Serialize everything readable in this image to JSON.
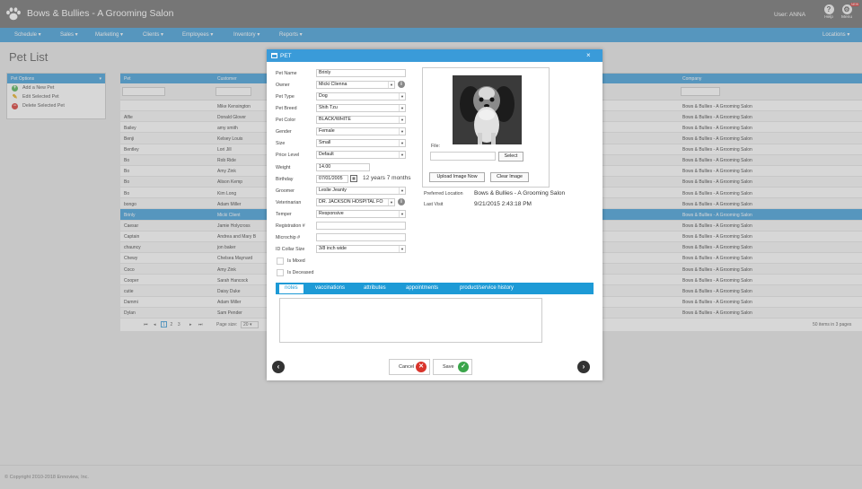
{
  "app": {
    "title": "Bows & Bullies - A Grooming Salon",
    "user_label": "User: ANNA",
    "help_label": "Help",
    "menu_label": "Menu",
    "menu_badge": "NEW",
    "accent_color": "#3a9bd9"
  },
  "nav": {
    "items": [
      "Schedule ▾",
      "Sales ▾",
      "Marketing ▾",
      "Clients ▾",
      "Employees ▾",
      "Inventory ▾",
      "Reports ▾"
    ],
    "locations": "Locations ▾"
  },
  "page": {
    "title": "Pet List"
  },
  "pet_options": {
    "title": "Pet Options",
    "items": [
      {
        "label": "Add a New Pet",
        "icon": "plus-icon"
      },
      {
        "label": "Edit Selected Pet",
        "icon": "pencil-icon"
      },
      {
        "label": "Delete Selected Pet",
        "icon": "minus-icon"
      }
    ]
  },
  "grid": {
    "columns": {
      "pet": "Pet",
      "customer": "Customer",
      "company": "Company"
    },
    "rows": [
      {
        "pet": "",
        "customer": "Mike Kensington",
        "company": "Bows & Bullies - A Grooming Salon"
      },
      {
        "pet": "Alfie",
        "customer": "Donald Glover",
        "company": "Bows & Bullies - A Grooming Salon"
      },
      {
        "pet": "Bailey",
        "customer": "amy smith",
        "company": "Bows & Bullies - A Grooming Salon"
      },
      {
        "pet": "Benji",
        "customer": "Kelsey Louis",
        "company": "Bows & Bullies - A Grooming Salon"
      },
      {
        "pet": "Bentley",
        "customer": "Lori Jill",
        "company": "Bows & Bullies - A Grooming Salon"
      },
      {
        "pet": "Bo",
        "customer": "Rob Ride",
        "company": "Bows & Bullies - A Grooming Salon"
      },
      {
        "pet": "Bo",
        "customer": "Amy Zink",
        "company": "Bows & Bullies - A Grooming Salon"
      },
      {
        "pet": "Bo",
        "customer": "Alison Kemp",
        "company": "Bows & Bullies - A Grooming Salon"
      },
      {
        "pet": "Bo",
        "customer": "Kim Long",
        "company": "Bows & Bullies - A Grooming Salon"
      },
      {
        "pet": "bongo",
        "customer": "Adam Miller",
        "company": "Bows & Bullies - A Grooming Salon"
      },
      {
        "pet": "Brinly",
        "customer": "Micki Client",
        "company": "Bows & Bullies - A Grooming Salon"
      },
      {
        "pet": "Caesar",
        "customer": "Jamie Holycross",
        "company": "Bows & Bullies - A Grooming Salon"
      },
      {
        "pet": "Captain",
        "customer": "Andrea and Mary B",
        "company": "Bows & Bullies - A Grooming Salon"
      },
      {
        "pet": "chauncy",
        "customer": "jon baker",
        "company": "Bows & Bullies - A Grooming Salon"
      },
      {
        "pet": "Chewy",
        "customer": "Chelsea Maynard",
        "company": "Bows & Bullies - A Grooming Salon"
      },
      {
        "pet": "Coco",
        "customer": "Amy Zink",
        "company": "Bows & Bullies - A Grooming Salon"
      },
      {
        "pet": "Cooper",
        "customer": "Sarah Hancock",
        "company": "Bows & Bullies - A Grooming Salon"
      },
      {
        "pet": "cutie",
        "customer": "Daisy Duke",
        "company": "Bows & Bullies - A Grooming Salon"
      },
      {
        "pet": "Dammi",
        "customer": "Adam Miller",
        "company": "Bows & Bullies - A Grooming Salon"
      },
      {
        "pet": "Dylan",
        "customer": "Sam Pender",
        "company": "Bows & Bullies - A Grooming Salon"
      }
    ],
    "selected_index": 10,
    "pager": {
      "pages": [
        "1",
        "2",
        "3"
      ],
      "current": "1",
      "first": "⏮",
      "prev": "◂",
      "next": "▸",
      "last": "⏭",
      "page_size_label": "Page size:",
      "page_size": "20",
      "summary": "50 items in 3 pages"
    }
  },
  "modal": {
    "title": "PET",
    "close": "×",
    "fields": {
      "pet_name": {
        "label": "Pet Name",
        "value": "Brinly"
      },
      "owner": {
        "label": "Owner",
        "value": "Micki Clienna"
      },
      "pet_type": {
        "label": "Pet Type",
        "value": "Dog"
      },
      "pet_breed": {
        "label": "Pet Breed",
        "value": "Shih Tzu"
      },
      "pet_color": {
        "label": "Pet Color",
        "value": "BLACK/WHITE"
      },
      "gender": {
        "label": "Gender",
        "value": "Female"
      },
      "size": {
        "label": "Size",
        "value": "Small"
      },
      "price_level": {
        "label": "Price Level",
        "value": "Default"
      },
      "weight": {
        "label": "Weight",
        "value": "14.00"
      },
      "birthday": {
        "label": "Birthday",
        "value": "07/01/2005",
        "age": "12 years 7 months"
      },
      "groomer": {
        "label": "Groomer",
        "value": "Leslie Jeanty"
      },
      "veterinarian": {
        "label": "Veterinarian",
        "value": "DR. JACKSON HOSPITAL FO"
      },
      "temper": {
        "label": "Temper",
        "value": "Responsive"
      },
      "registration": {
        "label": "Registration #",
        "value": ""
      },
      "microchip": {
        "label": "Microchip #",
        "value": ""
      },
      "id_collar_size": {
        "label": "ID Collar Size",
        "value": "3/8 inch wide"
      }
    },
    "is_mixed": "Is Mixed",
    "is_deceased": "Is Deceased",
    "file_label": "File:",
    "select_button": "Select",
    "upload_button": "Upload Image Now",
    "clear_button": "Clear Image",
    "preferred_location_label": "Preferred Location",
    "preferred_location": "Bows & Bullies - A Grooming Salon",
    "last_visit_label": "Last Visit",
    "last_visit": "9/21/2015 2:43:18 PM",
    "tabs": [
      "notes",
      "vaccinations",
      "attributes",
      "appointments",
      "product/service history"
    ],
    "active_tab": "notes",
    "cancel_label": "Cancel",
    "save_label": "Save",
    "prev_arrow": "‹",
    "next_arrow": "›"
  },
  "footer": {
    "copyright": "© Copyright 2010-2018 Ennoview, Inc."
  }
}
